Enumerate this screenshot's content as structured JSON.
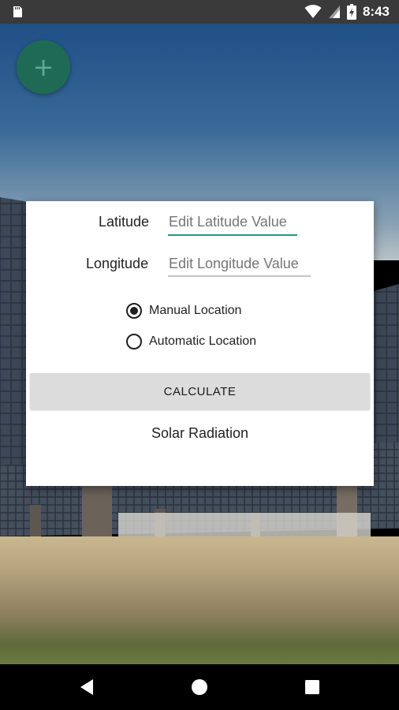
{
  "status_bar": {
    "time": "8:43",
    "icons": [
      "sd-card-icon",
      "wifi-icon",
      "signal-icon",
      "battery-charging-icon"
    ]
  },
  "fab": {
    "icon": "plus-icon",
    "glyph": "+"
  },
  "form": {
    "latitude_label": "Latitude",
    "latitude_placeholder": "Edit Latitude Value",
    "latitude_value": "",
    "longitude_label": "Longitude",
    "longitude_placeholder": "Edit Longitude Value",
    "longitude_value": "",
    "radio_options": [
      {
        "label": "Manual Location",
        "checked": true
      },
      {
        "label": "Automatic Location",
        "checked": false
      }
    ],
    "calculate_label": "CALCULATE",
    "result_text": "Solar Radiation"
  },
  "nav_bar": {
    "buttons": [
      "back-icon",
      "home-icon",
      "recents-icon"
    ]
  },
  "colors": {
    "accent": "#1d9b8a",
    "fab": "#1f6a55",
    "status_bar": "#3a3a3a",
    "button_bg": "#dcdcdc"
  }
}
